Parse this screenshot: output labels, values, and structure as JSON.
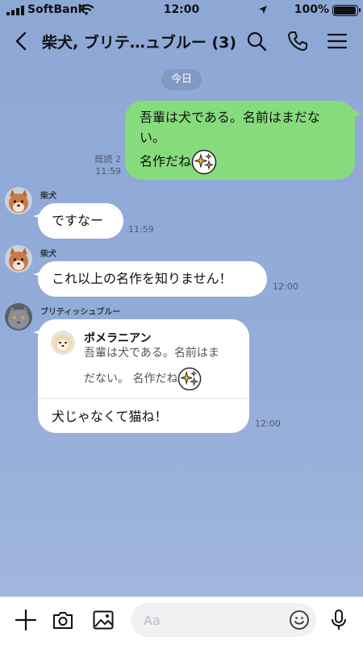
{
  "status_bar": {
    "carrier": "SoftBank",
    "time": "12:00",
    "battery": "100%",
    "battery_level": 1.0
  },
  "header": {
    "title": "柴犬, ブリテ…ュブルー (3)"
  },
  "date_divider": "今日",
  "messages": {
    "m1": {
      "line1": "吾輩は犬である。名前はまだな",
      "line2": "い。",
      "line3": "名作だね",
      "read": "既読 2",
      "time": "11:59"
    },
    "m2": {
      "sender": "柴犬",
      "text": "ですなー",
      "time": "11:59"
    },
    "m3": {
      "sender": "柴犬",
      "text": "これ以上の名作を知りません！",
      "time": "12:00"
    },
    "m4": {
      "sender": "ブリティッシュブルー",
      "quote_name": "ポメラニアン",
      "quote_line1": "吾輩は犬である。名前はま",
      "quote_line2": "だない。 名作だね",
      "text": "犬じゃなくて猫ね！",
      "time": "12:00"
    }
  },
  "composer": {
    "placeholder": "Aa"
  },
  "icons": {
    "back": "chevron-left-icon",
    "search": "search-icon",
    "call": "phone-icon",
    "menu": "hamburger-menu-icon",
    "add": "plus-icon",
    "camera": "camera-icon",
    "image": "image-icon",
    "emoji": "smiley-icon",
    "mic": "microphone-icon"
  },
  "colors": {
    "background": "#8ea8d6",
    "my_bubble": "#86dc7c",
    "their_bubble": "#ffffff"
  }
}
